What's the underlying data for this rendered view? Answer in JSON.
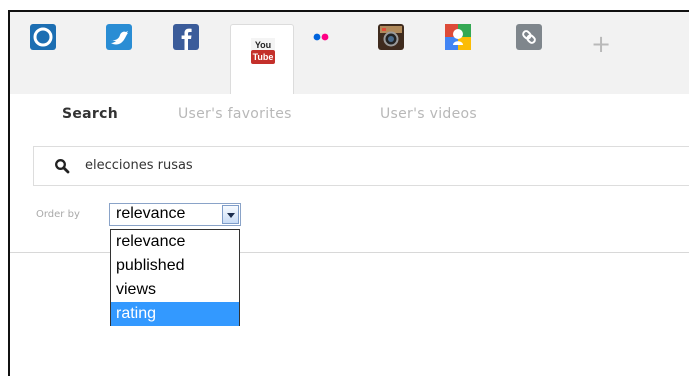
{
  "network_tabs": [
    {
      "icon": "spring-logo-icon",
      "color": "#1c6eb2"
    },
    {
      "icon": "twitter-icon",
      "color": "#2a8dd4"
    },
    {
      "icon": "facebook-icon",
      "color": "#3b5c9a"
    },
    {
      "icon": "youtube-icon",
      "color": "#c4302b",
      "active": true,
      "logo_top": "You",
      "logo_bottom": "Tube"
    },
    {
      "icon": "flickr-icon",
      "colors": [
        "#0063dc",
        "#ff0084"
      ]
    },
    {
      "icon": "instagram-icon",
      "color": "#3f2b1e"
    },
    {
      "icon": "google-plus-icon"
    },
    {
      "icon": "link-icon",
      "color": "#7f868c"
    }
  ],
  "add_tab_icon": "plus-icon",
  "subtabs": {
    "search": "Search",
    "favorites": "User's favorites",
    "videos": "User's videos"
  },
  "search": {
    "value": "elecciones rusas",
    "icon": "search-icon"
  },
  "order": {
    "label": "Order by",
    "selected": "relevance",
    "options": [
      "relevance",
      "published",
      "views",
      "rating"
    ],
    "highlighted": "rating"
  }
}
